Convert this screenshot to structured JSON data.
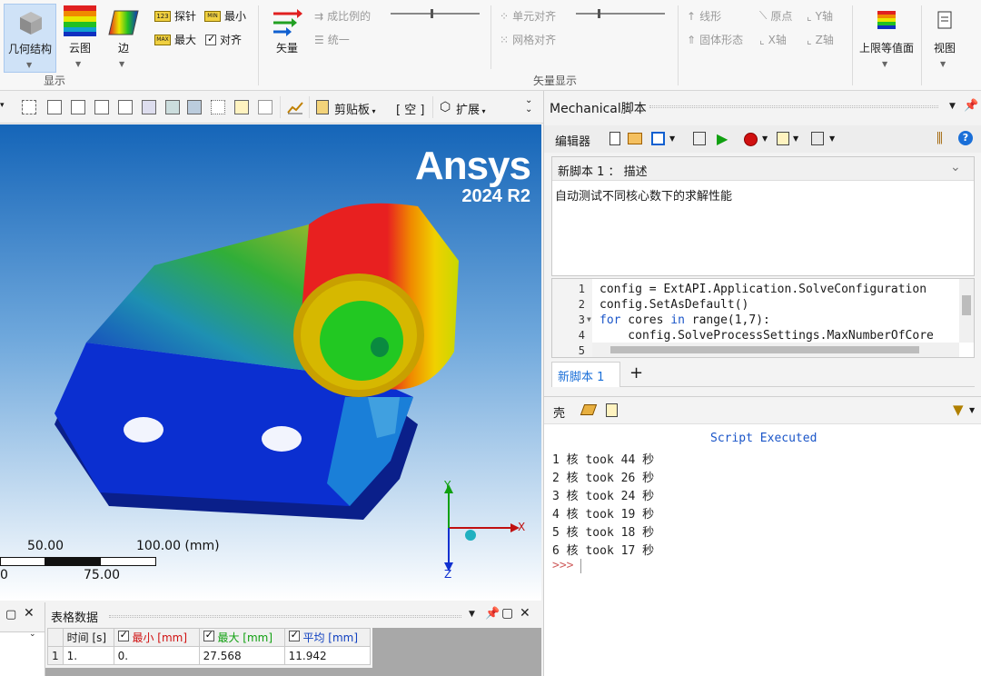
{
  "ribbon": {
    "geometry": "几何结构",
    "contour": "云图",
    "edge": "边",
    "probe": "探针",
    "min": "最小",
    "max": "最大",
    "align": "对齐",
    "vector": "矢量",
    "proportional": "成比例的",
    "uniform": "统一",
    "element_align": "单元对齐",
    "grid_align": "网格对齐",
    "line_form": "线形",
    "solid_form": "固体形态",
    "origin": "原点",
    "x_axis": "X轴",
    "y_axis": "Y轴",
    "z_axis": "Z轴",
    "upper_iso": "上限等值面",
    "view": "视图",
    "group_display": "显示",
    "group_vector_display": "矢量显示"
  },
  "toolbar": {
    "clipboard": "剪贴板",
    "empty": "[ 空 ]",
    "extend": "扩展"
  },
  "viewport": {
    "brand": "Ansys",
    "version": "2024 R2",
    "scale_top_mid": "50.00",
    "scale_top_right": "100.00 (mm)",
    "scale_bottom_left": "0",
    "scale_bottom_mid": "75.00",
    "axis_x": "X",
    "axis_y": "Y",
    "axis_z": "Z"
  },
  "table_panel": {
    "title": "表格数据",
    "headers": [
      "时间 [s]",
      "最小 [mm]",
      "最大 [mm]",
      "平均 [mm]"
    ],
    "rows": [
      {
        "idx": "1",
        "time": "1.",
        "min": "0.",
        "max": "27.568",
        "avg": "11.942"
      }
    ]
  },
  "script_panel": {
    "title": "Mechanical脚本",
    "editor_label": "编辑器",
    "script_header": "新脚本 1 ： 描述",
    "description": "自动测试不同核心数下的求解性能",
    "line_numbers": [
      "1",
      "2",
      "3",
      "4",
      "5"
    ],
    "code_line1": "config = ExtAPI.Application.SolveConfiguration",
    "code_line2": "config.SetAsDefault()",
    "code_line3_kw": "for",
    "code_line3_var": " cores ",
    "code_line3_in": "in",
    "code_line3_rest": " range(1,7):",
    "code_line4": "    config.SolveProcessSettings.MaxNumberOfCore",
    "tab": "新脚本 1",
    "add_tab": "+",
    "shell_label": "壳",
    "status": "Script Executed",
    "output": [
      "1 核 took 44 秒",
      "2 核 took 26 秒",
      "3 核 took 24 秒",
      "4 核 took 19 秒",
      "5 核 took 18 秒",
      "6 核 took 17 秒"
    ],
    "prompt": ">>>"
  }
}
